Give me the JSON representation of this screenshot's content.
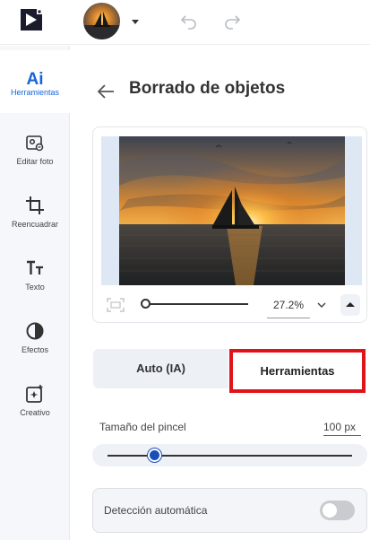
{
  "topbar": {
    "logo": "video-editor-logo-icon",
    "avatar": "sailboat-sunset-thumbnail",
    "undo_icon": "undo-icon",
    "redo_icon": "redo-icon"
  },
  "sidebar": {
    "items": [
      {
        "label": "Herramientas",
        "icon": "ai-icon",
        "glyph": "Ai",
        "active": true
      },
      {
        "label": "Editar foto",
        "icon": "photo-edit-icon",
        "active": false
      },
      {
        "label": "Reencuadrar",
        "icon": "crop-icon",
        "active": false
      },
      {
        "label": "Texto",
        "icon": "text-icon",
        "active": false
      },
      {
        "label": "Efectos",
        "icon": "effects-icon",
        "active": false
      },
      {
        "label": "Creativo",
        "icon": "creative-icon",
        "active": false
      }
    ]
  },
  "panel": {
    "title": "Borrado de objetos",
    "zoom": "27.2%",
    "zoom_slider_fraction": 0.02,
    "tabs": {
      "auto": "Auto (IA)",
      "tools": "Herramientas",
      "selected": "tools"
    },
    "brush": {
      "label": "Tamaño del pincel",
      "value": "100 px",
      "slider_fraction": 0.19
    },
    "detect": {
      "label": "Detección automática",
      "enabled": false
    }
  },
  "colors": {
    "accent": "#1565d8",
    "highlight_border": "#e0131b",
    "slider_knob": "#1a4fb5"
  }
}
